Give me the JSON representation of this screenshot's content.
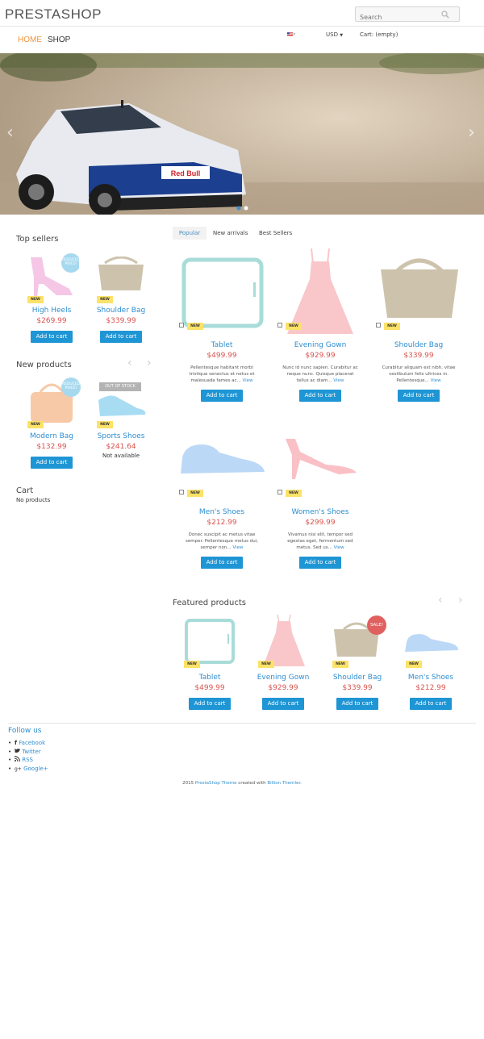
{
  "header": {
    "brand": "PRESTASHOP",
    "search_placeholder": "Search",
    "nav": [
      {
        "label": "HOME"
      },
      {
        "label": "SHOP"
      }
    ],
    "currency": "USD",
    "cart": "Cart: (empty)"
  },
  "sidebar": {
    "top_sellers": {
      "title": "Top sellers",
      "items": [
        {
          "name": "High Heels",
          "price": "$269.99",
          "badge": "NEW",
          "sticker": "REDUCED PRICE!",
          "button": "Add to cart"
        },
        {
          "name": "Shoulder Bag",
          "price": "$339.99",
          "badge": "NEW",
          "button": "Add to cart"
        }
      ]
    },
    "new_products": {
      "title": "New products",
      "items": [
        {
          "name": "Modern Bag",
          "price": "$132.99",
          "badge": "NEW",
          "sticker": "REDUCED PRICE!",
          "button": "Add to cart"
        },
        {
          "name": "Sports Shoes",
          "price": "$241.64",
          "badge": "NEW",
          "sticker": "OUT OF STOCK",
          "availability": "Not available"
        }
      ]
    },
    "cart": {
      "title": "Cart",
      "empty": "No products"
    }
  },
  "tabs": [
    {
      "label": "Popular"
    },
    {
      "label": "New arrivals"
    },
    {
      "label": "Best Sellers"
    }
  ],
  "popular": [
    {
      "name": "Tablet",
      "price": "$499.99",
      "badge": "NEW",
      "desc": "Pellentesque habitant morbi tristique senectus et netus et malesuada fames ac...",
      "view": "View",
      "button": "Add to cart"
    },
    {
      "name": "Evening Gown",
      "price": "$929.99",
      "badge": "NEW",
      "desc": "Nunc id nunc sapien. Curabitur ac neque nunc. Quisque placerat tellus ac diam...",
      "view": "View",
      "button": "Add to cart"
    },
    {
      "name": "Shoulder Bag",
      "price": "$339.99",
      "badge": "NEW",
      "desc": "Curabitur aliquam est nibh, vitae vestibulum felis ultrices in. Pellentesque...",
      "view": "View",
      "button": "Add to cart"
    },
    {
      "name": "Men's Shoes",
      "price": "$212.99",
      "badge": "NEW",
      "desc": "Donec suscipit ac metus vitae semper. Pellentesque metus dui, semper non...",
      "view": "View",
      "button": "Add to cart"
    },
    {
      "name": "Women's Shoes",
      "price": "$299.99",
      "badge": "NEW",
      "desc": "Vivamus nisi elit, tempor sed egestas eget, fermentum sed metus. Sed us...",
      "view": "View",
      "button": "Add to cart"
    }
  ],
  "featured": {
    "title": "Featured products",
    "items": [
      {
        "name": "Tablet",
        "price": "$499.99",
        "badge": "NEW",
        "button": "Add to cart"
      },
      {
        "name": "Evening Gown",
        "price": "$929.99",
        "badge": "NEW",
        "button": "Add to cart"
      },
      {
        "name": "Shoulder Bag",
        "price": "$339.99",
        "badge": "NEW",
        "sticker": "SALE!",
        "button": "Add to cart"
      },
      {
        "name": "Men's Shoes",
        "price": "$212.99",
        "badge": "NEW",
        "button": "Add to cart"
      }
    ]
  },
  "follow": {
    "title": "Follow us",
    "links": [
      {
        "icon": "facebook-icon",
        "label": "Facebook"
      },
      {
        "icon": "twitter-icon",
        "label": "Twitter"
      },
      {
        "icon": "rss-icon",
        "label": "RSS"
      },
      {
        "icon": "google-plus-icon",
        "label": "Google+"
      }
    ]
  },
  "footer": {
    "year": "2015",
    "theme_link": "PrestaShop Theme",
    "mid": "created with",
    "maker_link": "Billion Themler",
    "end": "."
  },
  "colors": {
    "accent": "#1e95d4",
    "price": "#d9534f",
    "name": "#2e8ed0",
    "badge": "#fce268",
    "home": "#f0943d"
  }
}
